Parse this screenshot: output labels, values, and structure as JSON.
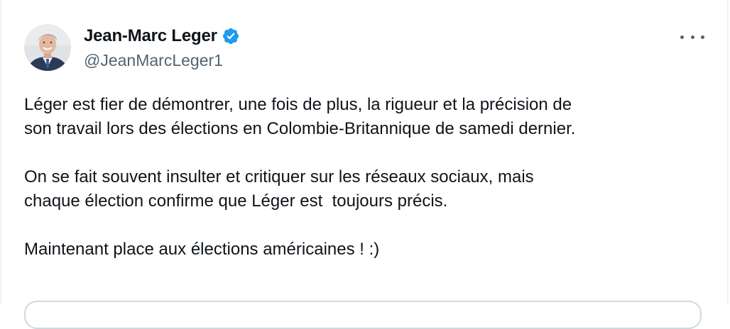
{
  "author": {
    "display_name": "Jean-Marc Leger",
    "handle": "@JeanMarcLeger1",
    "verified": true,
    "avatar_icon": "profile-photo-icon",
    "verified_icon": "verified-badge-icon",
    "badge_color": "#1d9bf0"
  },
  "tweet": {
    "paragraphs": [
      [
        "Léger est fier de démontrer, une fois de plus, la rigueur et la précision de",
        "son travail lors des élections en Colombie-Britannique de samedi dernier."
      ],
      [
        "On se fait souvent insulter et critiquer sur les réseaux sociaux, mais",
        "chaque élection confirme que Léger est  toujours précis."
      ],
      [
        "Maintenant place aux élections américaines ! :)"
      ]
    ]
  },
  "menu": {
    "icon": "more-options-icon"
  },
  "colors": {
    "text": "#0f1419",
    "secondary_text": "#536471",
    "border": "#eff3f4"
  }
}
